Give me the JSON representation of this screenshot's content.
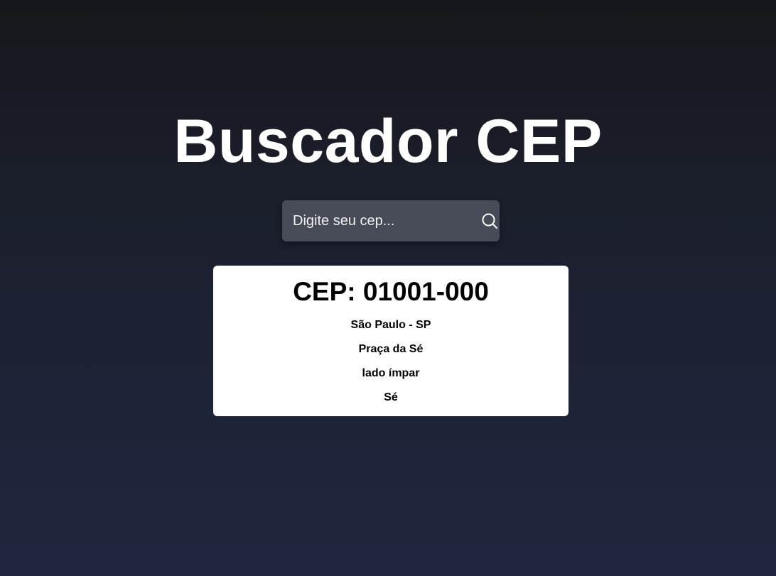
{
  "app": {
    "title": "Buscador CEP"
  },
  "search": {
    "placeholder": "Digite seu cep...",
    "value": "",
    "button_icon": "search-icon"
  },
  "result": {
    "cep_prefix": "CEP: 01001-000",
    "city_state": "São Paulo - SP",
    "street": "Praça da Sé",
    "complement": "lado ímpar",
    "neighborhood": "Sé"
  },
  "colors": {
    "background_top": "#16171b",
    "background_bottom": "#1f2740",
    "search_bg": "#474b57",
    "card_bg": "#ffffff",
    "text_light": "#ffffff",
    "text_dark": "#000000"
  }
}
